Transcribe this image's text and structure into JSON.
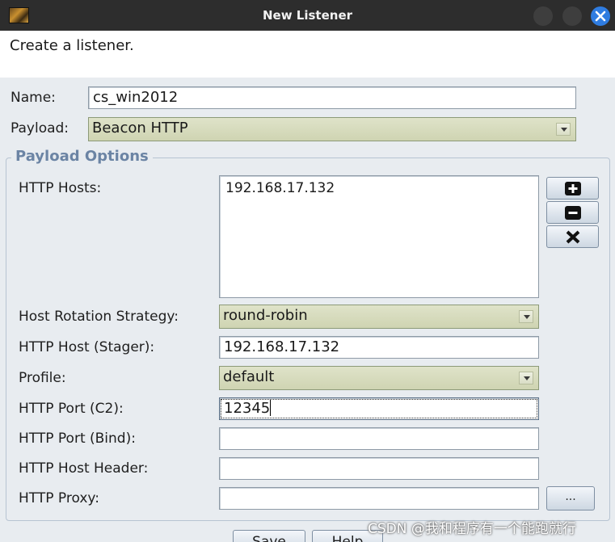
{
  "window": {
    "title": "New Listener",
    "description": "Create a listener."
  },
  "form": {
    "name_label": "Name:",
    "name_value": "cs_win2012",
    "payload_label": "Payload:",
    "payload_value": "Beacon HTTP"
  },
  "payload_options": {
    "group_title": "Payload Options",
    "http_hosts_label": "HTTP Hosts:",
    "http_hosts": [
      "192.168.17.132"
    ],
    "host_rotation_label": "Host Rotation Strategy:",
    "host_rotation_value": "round-robin",
    "stager_host_label": "HTTP Host (Stager):",
    "stager_host_value": "192.168.17.132",
    "profile_label": "Profile:",
    "profile_value": "default",
    "port_c2_label": "HTTP Port (C2):",
    "port_c2_value": "12345",
    "port_bind_label": "HTTP Port (Bind):",
    "port_bind_value": "",
    "host_header_label": "HTTP Host Header:",
    "host_header_value": "",
    "proxy_label": "HTTP Proxy:",
    "proxy_value": "",
    "proxy_button_label": "..."
  },
  "buttons": {
    "save": "Save",
    "help": "Help"
  },
  "watermark": "CSDN @我和程序有一个能跑就行",
  "colors": {
    "titlebar": "#2d2d2d",
    "close_button": "#2f7ce0",
    "group_title": "#6b84a4",
    "combo_fill": "#d6dbbd",
    "dialog_bg": "#e8ecf0"
  },
  "icons": {
    "app": "cobalt-strike-app-icon",
    "add_host": "plus-icon",
    "remove_host": "minus-icon",
    "clear_hosts": "x-icon",
    "close": "close-icon"
  }
}
